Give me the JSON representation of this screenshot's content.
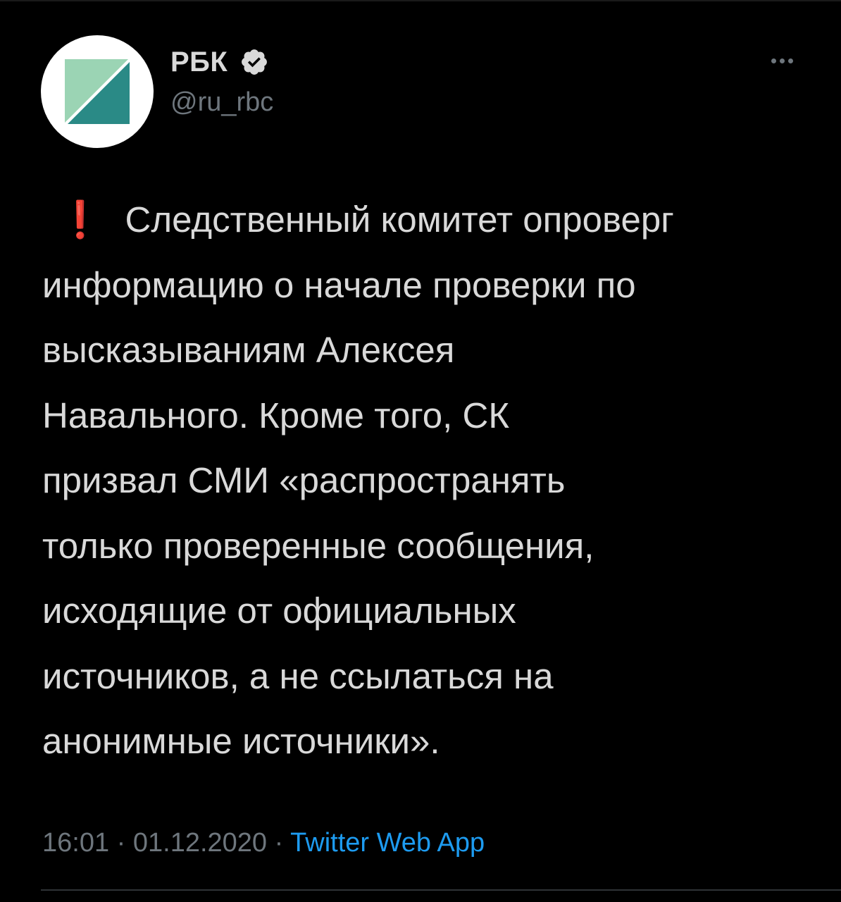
{
  "author": {
    "name": "РБК",
    "handle": "@ru_rbc",
    "verified": true
  },
  "tweet": {
    "emoji": "❗",
    "lines": [
      "Следственный комитет опроверг",
      "информацию о начале проверки по",
      "высказываниям Алексея",
      "Навального. Кроме того, СК",
      "призвал СМИ «распространять",
      "только проверенные сообщения,",
      "исходящие от официальных",
      "источников, а не ссылаться на",
      "анонимные источники»."
    ]
  },
  "meta": {
    "time": "16:01",
    "date": "01.12.2020",
    "separator": "·",
    "source": "Twitter Web App"
  },
  "icons": {
    "avatar": "rbc-logo",
    "verified": "verified-badge-icon",
    "more": "more-options-icon"
  },
  "colors": {
    "background": "#000000",
    "text": "#d9d9d9",
    "secondary": "#6e767d",
    "link": "#1d9bf0",
    "alert": "#e0141e",
    "logo_light": "#9bd4b4",
    "logo_dark": "#2a8a86"
  }
}
